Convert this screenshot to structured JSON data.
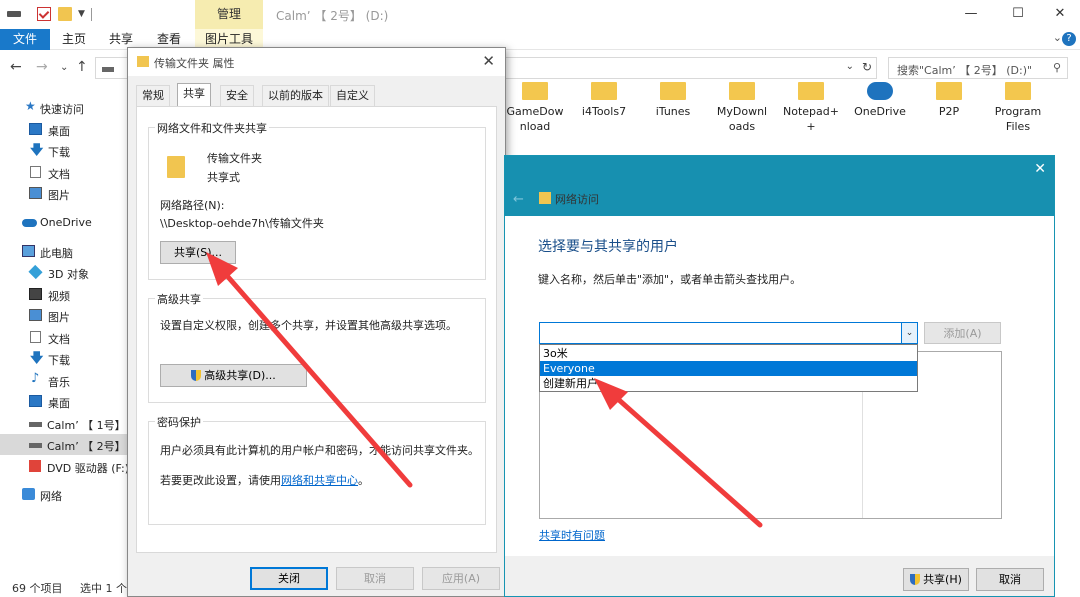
{
  "titlebar": {
    "manage_tab": "管理",
    "title": "Calmʼ 【 2号】 (D:)",
    "minimize": "—",
    "maximize": "☐",
    "close": "✕"
  },
  "ribbon": {
    "tabs": [
      "文件",
      "主页",
      "共享",
      "查看",
      "图片工具"
    ],
    "chevron": "⌄",
    "help": "?"
  },
  "address": {
    "back": "←",
    "forward": "→",
    "up_list": "⌄",
    "up": "↑",
    "dropdown": "⌄",
    "refresh": "↻",
    "search_placeholder": "搜索\"Calmʼ 【 2号】 (D:)\"",
    "search_icon": "⚲"
  },
  "nav": {
    "items": [
      {
        "label": "快速访问",
        "icon": "star-icon"
      },
      {
        "label": "桌面",
        "icon": "desktop-icon"
      },
      {
        "label": "下载",
        "icon": "download-icon"
      },
      {
        "label": "文档",
        "icon": "document-icon"
      },
      {
        "label": "图片",
        "icon": "pictures-icon"
      },
      {
        "label": "OneDrive",
        "icon": "cloud-icon"
      },
      {
        "label": "此电脑",
        "icon": "computer-icon"
      },
      {
        "label": "3D 对象",
        "icon": "3d-objects-icon"
      },
      {
        "label": "视频",
        "icon": "video-icon"
      },
      {
        "label": "图片",
        "icon": "pictures-icon"
      },
      {
        "label": "文档",
        "icon": "document-icon"
      },
      {
        "label": "下载",
        "icon": "download-icon"
      },
      {
        "label": "音乐",
        "icon": "music-icon"
      },
      {
        "label": "桌面",
        "icon": "desktop-icon"
      },
      {
        "label": "Calmʼ 【 1号】",
        "icon": "drive-icon"
      },
      {
        "label": "Calmʼ 【 2号】",
        "icon": "drive-icon"
      },
      {
        "label": "DVD 驱动器 (F:)",
        "icon": "dvd-icon"
      },
      {
        "label": "网络",
        "icon": "network-icon"
      }
    ]
  },
  "files": [
    {
      "line1": "GameDow",
      "line2": "nload"
    },
    {
      "line1": "i4Tools7",
      "line2": ""
    },
    {
      "line1": "iTunes",
      "line2": ""
    },
    {
      "line1": "MyDownl",
      "line2": "oads"
    },
    {
      "line1": "Notepad+",
      "line2": "+"
    },
    {
      "line1": "OneDrive",
      "line2": ""
    },
    {
      "line1": "P2P",
      "line2": ""
    },
    {
      "line1": "Program",
      "line2": "Files"
    }
  ],
  "status": {
    "count": "69 个项目",
    "selected": "选中 1 个"
  },
  "props": {
    "title": "传输文件夹 属性",
    "close": "✕",
    "tabs": [
      "常规",
      "共享",
      "安全",
      "以前的版本",
      "自定义"
    ],
    "net_share_group": "网络文件和文件夹共享",
    "folder_name": "传输文件夹",
    "folder_state": "共享式",
    "path_label": "网络路径(N):",
    "path_value": "\\\\Desktop-oehde7h\\传输文件夹",
    "share_btn": "共享(S)...",
    "adv_group": "高级共享",
    "adv_desc": "设置自定义权限，创建多个共享，并设置其他高级共享选项。",
    "adv_btn": "高级共享(D)...",
    "pwd_group": "密码保护",
    "pwd_desc": "用户必须具有此计算机的用户帐户和密码，才能访问共享文件夹。",
    "pwd_change_prefix": "若要更改此设置，请使用",
    "pwd_link": "网络和共享中心",
    "pwd_change_suffix": "。",
    "close_btn": "关闭",
    "cancel_btn": "取消",
    "apply_btn": "应用(A)"
  },
  "net": {
    "back": "←",
    "title": "网络访问",
    "close": "✕",
    "heading": "选择要与其共享的用户",
    "instruction": "键入名称，然后单击\"添加\"，或者单击箭头查找用户。",
    "combo_value": "",
    "combo_arrow": "⌄",
    "options": [
      "3o米",
      "Everyone",
      "创建新用户..."
    ],
    "selected_option": "Everyone",
    "add_btn": "添加(A)",
    "help_link": "共享时有问题",
    "share_btn": "共享(H)",
    "cancel_btn": "取消"
  },
  "colors": {
    "accent": "#1979ca",
    "net_header": "#1790b0",
    "selection": "#0078d7",
    "annotation_arrow": "#f03c3c"
  }
}
